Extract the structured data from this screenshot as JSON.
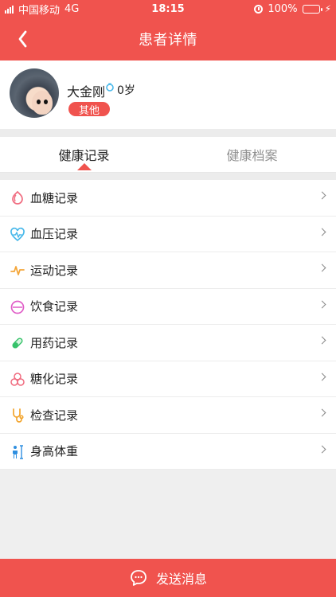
{
  "status_bar": {
    "carrier": "中国移动",
    "network": "4G",
    "time": "18:15",
    "battery_percent": "100%",
    "battery_level": 1.0
  },
  "header": {
    "title": "患者详情"
  },
  "patient": {
    "name": "大金刚",
    "age": "0岁",
    "tag": "其他"
  },
  "tabs": [
    {
      "label": "健康记录"
    },
    {
      "label": "健康档案"
    }
  ],
  "records": [
    {
      "label": "血糖记录",
      "icon": "blood-sugar-icon",
      "color": "#f06b7f"
    },
    {
      "label": "血压记录",
      "icon": "heart-pulse-icon",
      "color": "#48b8ea"
    },
    {
      "label": "运动记录",
      "icon": "activity-icon",
      "color": "#f4a63a"
    },
    {
      "label": "饮食记录",
      "icon": "diet-icon",
      "color": "#e05cc7"
    },
    {
      "label": "用药记录",
      "icon": "pill-icon",
      "color": "#36c26a"
    },
    {
      "label": "糖化记录",
      "icon": "hba1c-icon",
      "color": "#f06b7f"
    },
    {
      "label": "检查记录",
      "icon": "stethoscope-icon",
      "color": "#f3a52d"
    },
    {
      "label": "身高体重",
      "icon": "height-weight-icon",
      "color": "#2f8fe0"
    }
  ],
  "footer": {
    "action_label": "发送消息"
  },
  "colors": {
    "brand": "#f0534e"
  }
}
